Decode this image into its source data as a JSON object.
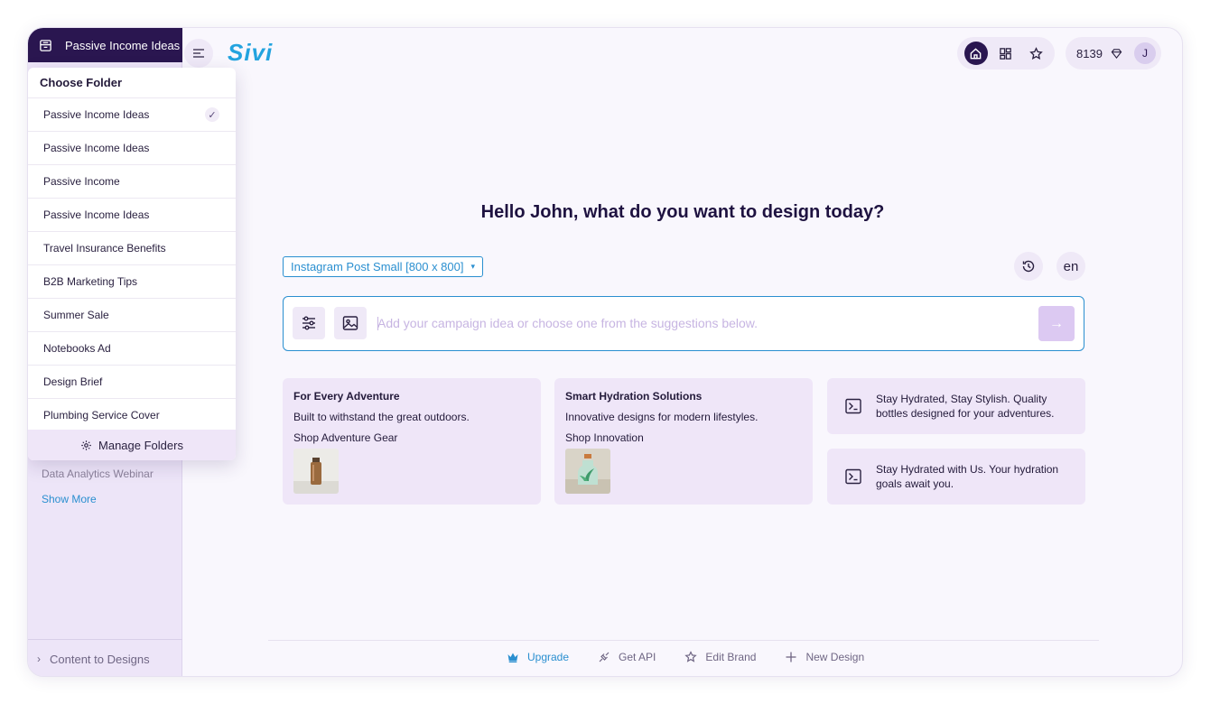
{
  "app": {
    "logo_text": "Sivi",
    "brand_color": "#2a1650",
    "accent_color": "#2a8fd0"
  },
  "sidebar": {
    "current_folder": "Passive Income Ideas",
    "visible_items": [
      {
        "label": "Data Analytics Webinar"
      }
    ],
    "show_more_label": "Show More",
    "bottom_label": "Content to Designs"
  },
  "folder_dropdown": {
    "title": "Choose Folder",
    "items": [
      {
        "label": "Passive Income Ideas",
        "selected": true
      },
      {
        "label": "Passive Income Ideas",
        "selected": false
      },
      {
        "label": "Passive Income",
        "selected": false
      },
      {
        "label": "Passive Income Ideas",
        "selected": false
      },
      {
        "label": "Travel Insurance Benefits",
        "selected": false
      },
      {
        "label": "B2B Marketing Tips",
        "selected": false
      },
      {
        "label": "Summer Sale",
        "selected": false
      },
      {
        "label": "Notebooks Ad",
        "selected": false
      },
      {
        "label": "Design Brief",
        "selected": false
      },
      {
        "label": "Plumbing Service Cover",
        "selected": false
      }
    ],
    "check_glyph": "✓",
    "manage_label": "Manage Folders"
  },
  "header": {
    "nav_icons": [
      "home-icon",
      "grid-icon",
      "star-icon"
    ],
    "credits": "8139",
    "avatar_initial": "J"
  },
  "main": {
    "greeting": "Hello John, what do you want to design today?",
    "size_select": "Instagram Post Small [800 x 800]",
    "language": "en",
    "prompt_placeholder": "Add your campaign idea or choose one from the suggestions below.",
    "suggestions_rich": [
      {
        "title": "For Every Adventure",
        "subtitle": "Built to withstand the great outdoors.",
        "cta": "Shop Adventure Gear"
      },
      {
        "title": "Smart Hydration Solutions",
        "subtitle": "Innovative designs for modern lifestyles.",
        "cta": "Shop Innovation"
      }
    ],
    "suggestions_text": [
      {
        "text": "Stay Hydrated, Stay Stylish. Quality bottles designed for your adventures."
      },
      {
        "text": "Stay Hydrated with Us. Your hydration goals await you."
      }
    ]
  },
  "footer": {
    "upgrade": "Upgrade",
    "get_api": "Get API",
    "edit_brand": "Edit Brand",
    "new_design": "New Design"
  }
}
